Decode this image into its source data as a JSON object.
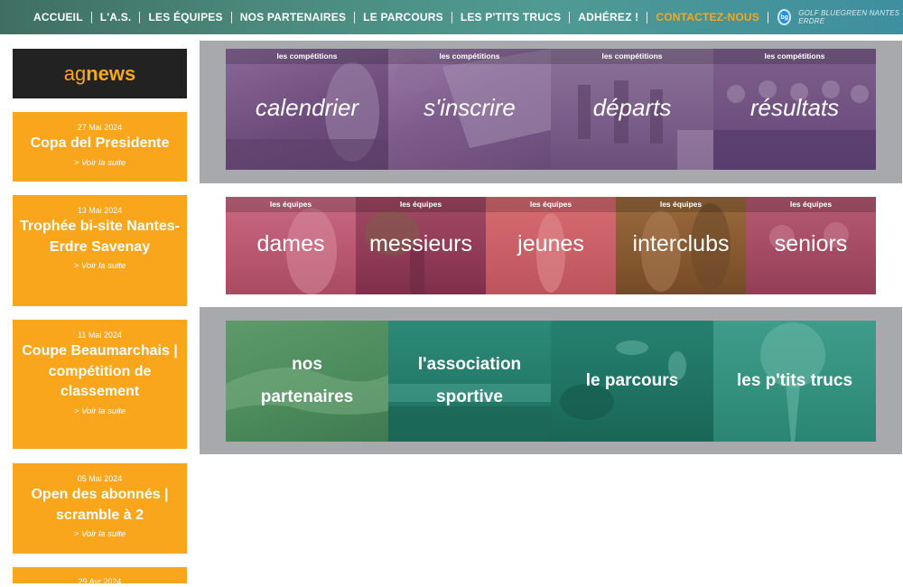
{
  "nav": {
    "items": [
      "ACCUEIL",
      "L'A.S.",
      "LES ÉQUIPES",
      "NOS PARTENAIRES",
      "LE PARCOURS",
      "LES P'TITS TRUCS",
      "ADHÉREZ !",
      "CONTACTEZ-NOUS"
    ],
    "brand_text": "GOLF BLUEGREEN NANTES ERDRE",
    "brand_logo": "bg"
  },
  "sidebar": {
    "title_prefix": "ag",
    "title_suffix": "news",
    "news": [
      {
        "date": "27 Mai 2024",
        "title": "Copa del Presidente",
        "more": "> Voir la suite"
      },
      {
        "date": "13 Mai 2024",
        "title": "Trophée bi-site Nantes-Erdre Savenay",
        "more": "> Voir la suite"
      },
      {
        "date": "11 Mai 2024",
        "title": "Coupe Beaumarchais | compétition de classement",
        "more": "> Voir la suite"
      },
      {
        "date": "05 Mai 2024",
        "title": "Open des abonnés | scramble à 2",
        "more": "> Voir la suite"
      },
      {
        "date": "29 Avr 2024",
        "title": "",
        "more": ""
      }
    ]
  },
  "competitions": [
    {
      "tag": "les compétitions",
      "label": "calendrier"
    },
    {
      "tag": "les compétitions",
      "label": "s'inscrire"
    },
    {
      "tag": "les compétitions",
      "label": "départs"
    },
    {
      "tag": "les compétitions",
      "label": "résultats"
    }
  ],
  "teams": [
    {
      "tag": "les équipes",
      "label": "dames"
    },
    {
      "tag": "les équipes",
      "label": "messieurs"
    },
    {
      "tag": "les équipes",
      "label": "jeunes"
    },
    {
      "tag": "les équipes",
      "label": "interclubs"
    },
    {
      "tag": "les équipes",
      "label": "seniors"
    }
  ],
  "links": [
    {
      "line1": "nos",
      "line2": "partenaires"
    },
    {
      "line1": "l'association",
      "line2": "sportive"
    },
    {
      "line1": "le parcours",
      "line2": ""
    },
    {
      "line1": "les p'tits trucs",
      "line2": ""
    }
  ],
  "colors": {
    "accent": "#f9a61c",
    "nav_bg": "#4a8a7c",
    "competition_tile": "#7a4f86",
    "panel_gray": "#a7a9ac"
  }
}
